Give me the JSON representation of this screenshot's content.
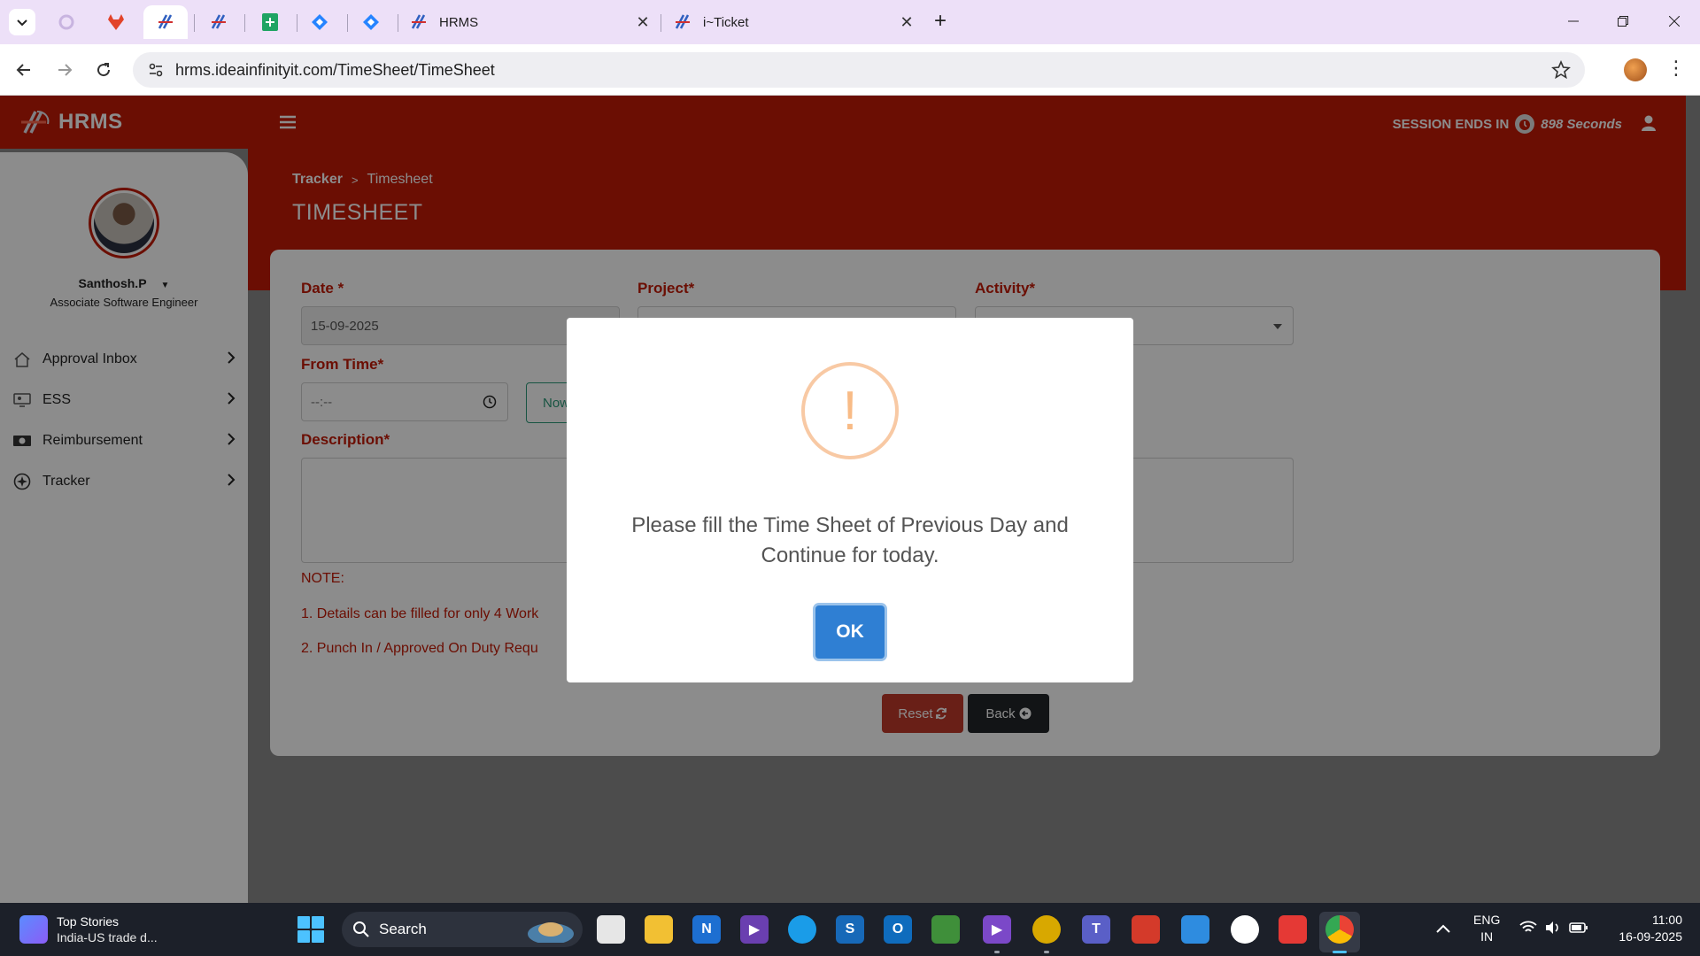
{
  "browser": {
    "tabs": [
      {
        "title": "HRMS"
      },
      {
        "title": "i~Ticket"
      }
    ],
    "url": "hrms.ideainfinityit.com/TimeSheet/TimeSheet"
  },
  "header": {
    "logo": "HRMS",
    "session_label": "SESSION ENDS IN",
    "session_seconds": "898 Seconds"
  },
  "breadcrumb": {
    "root": "Tracker",
    "sep": ">",
    "current": "Timesheet"
  },
  "page_title": "TIMESHEET",
  "sidebar": {
    "user_name": "Santhosh.P",
    "user_role": "Associate Software Engineer",
    "items": [
      {
        "label": "Approval Inbox",
        "icon": "home-icon"
      },
      {
        "label": "ESS",
        "icon": "monitor-icon"
      },
      {
        "label": "Reimbursement",
        "icon": "money-icon"
      },
      {
        "label": "Tracker",
        "icon": "tracker-icon"
      }
    ]
  },
  "form": {
    "date_label": "Date *",
    "date_value": "15-09-2025",
    "project_label": "Project*",
    "activity_label": "Activity*",
    "from_time_label": "From Time*",
    "from_time_placeholder": "--:--",
    "now_label": "Now",
    "description_label": "Description*",
    "note_title": "NOTE:",
    "note_1": "1. Details can be filled for only 4 Work",
    "note_2": "2. Punch In / Approved On Duty Requ",
    "reset_label": "Reset",
    "back_label": "Back"
  },
  "modal": {
    "icon": "!",
    "message": "Please fill the Time Sheet of Previous Day and Continue for today.",
    "ok_label": "OK"
  },
  "taskbar": {
    "news_title": "Top Stories",
    "news_sub": "India-US trade d...",
    "search_label": "Search",
    "lang_1": "ENG",
    "lang_2": "IN",
    "time": "11:00",
    "date": "16-09-2025"
  },
  "colors": {
    "brand_red": "#c41a06",
    "ok_blue": "#2f7fd3",
    "warn_orange": "#f8bb86"
  }
}
